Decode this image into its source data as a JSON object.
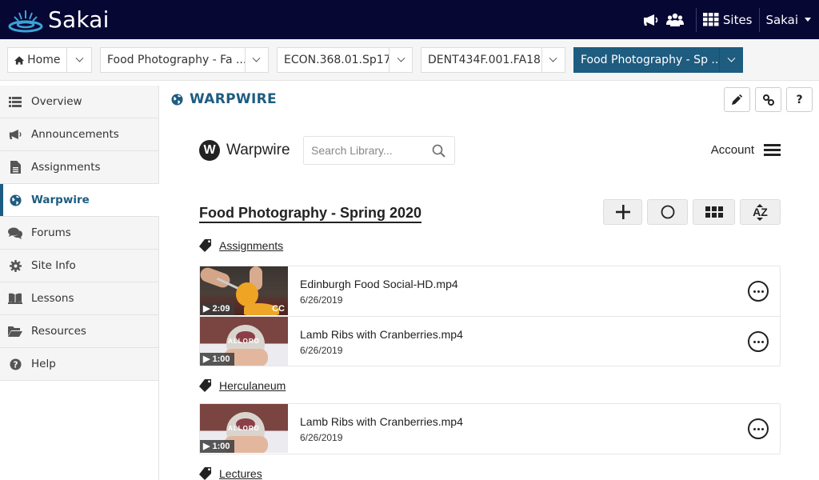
{
  "topbar": {
    "logo_text": "Sakai",
    "icons": [
      "megaphone-icon",
      "users-icon"
    ],
    "sites_label": "Sites",
    "user_label": "Sakai"
  },
  "site_tabs": [
    {
      "label": "Home",
      "icon": "home-icon",
      "active": false
    },
    {
      "label": "Food Photography - Fa ...",
      "active": false
    },
    {
      "label": "ECON.368.01.Sp17",
      "active": false
    },
    {
      "label": "DENT434F.001.FA18",
      "active": false
    },
    {
      "label": "Food Photography - Sp ...",
      "active": true
    }
  ],
  "sidebar": {
    "items": [
      {
        "label": "Overview",
        "icon": "list-icon"
      },
      {
        "label": "Announcements",
        "icon": "megaphone-icon"
      },
      {
        "label": "Assignments",
        "icon": "file-icon"
      },
      {
        "label": "Warpwire",
        "icon": "globe-icon",
        "active": true
      },
      {
        "label": "Forums",
        "icon": "comments-icon"
      },
      {
        "label": "Site Info",
        "icon": "gear-icon"
      },
      {
        "label": "Lessons",
        "icon": "book-icon"
      },
      {
        "label": "Resources",
        "icon": "folder-open-icon"
      },
      {
        "label": "Help",
        "icon": "question-circle-icon"
      }
    ]
  },
  "tool": {
    "title": "WARPWIRE",
    "buttons": [
      "edit-icon",
      "link-icon",
      "help-icon"
    ],
    "help_label": "?"
  },
  "warpwire": {
    "logo_letter": "W",
    "brand": "Warpwire",
    "search_placeholder": "Search Library...",
    "search_value": "",
    "account_label": "Account",
    "library_title": "Food Photography - Spring 2020",
    "sort_label": "AZ",
    "groups": [
      {
        "tag": "Assignments",
        "items": [
          {
            "title": "Edinburgh Food Social-HD.mp4",
            "date": "6/26/2019",
            "duration": "2:09",
            "cc": "CC"
          },
          {
            "title": "Lamb Ribs with Cranberries.mp4",
            "date": "6/26/2019",
            "duration": "1:00",
            "thumb_text": "ALLORO"
          }
        ]
      },
      {
        "tag": "Herculaneum",
        "items": [
          {
            "title": "Lamb Ribs with Cranberries.mp4",
            "date": "6/26/2019",
            "duration": "1:00",
            "thumb_text": "ALLORO"
          }
        ]
      },
      {
        "tag": "Lectures",
        "items": []
      }
    ]
  },
  "colors": {
    "topbar_bg": "#070734",
    "accent": "#1e5c80",
    "sidebar_bg": "#f5f5f5"
  }
}
